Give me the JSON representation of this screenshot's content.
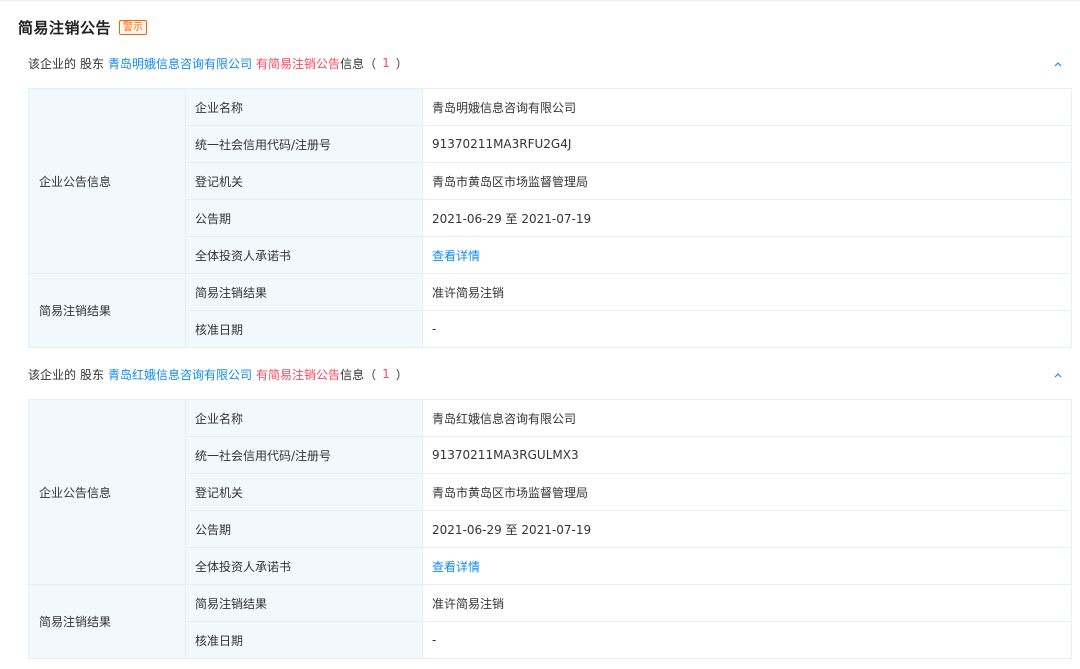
{
  "section": {
    "title": "简易注销公告",
    "badge": "警示"
  },
  "header": {
    "prefix": "该企业的",
    "role": "股东",
    "has_notice": "有简易注销公告",
    "info": "信息",
    "open_paren": "（",
    "close_paren": "）",
    "toggle_icon": "chevron-up-icon"
  },
  "labels": {
    "enterprise_notice": "企业公告信息",
    "result_group": "简易注销结果",
    "company_name": "企业名称",
    "credit_code": "统一社会信用代码/注册号",
    "registration_authority": "登记机关",
    "notice_period": "公告期",
    "investor_commitment": "全体投资人承诺书",
    "cancellation_result": "简易注销结果",
    "approval_date": "核准日期"
  },
  "groups": [
    {
      "shareholder": "青岛明娥信息咨询有限公司",
      "count": "1",
      "company_name": "青岛明娥信息咨询有限公司",
      "credit_code": "91370211MA3RFU2G4J",
      "registration_authority": "青岛市黄岛区市场监督管理局",
      "notice_period": "2021-06-29 至 2021-07-19",
      "investor_commitment": "查看详情",
      "cancellation_result": "准许简易注销",
      "approval_date": "-"
    },
    {
      "shareholder": "青岛红娥信息咨询有限公司",
      "count": "1",
      "company_name": "青岛红娥信息咨询有限公司",
      "credit_code": "91370211MA3RGULMX3",
      "registration_authority": "青岛市黄岛区市场监督管理局",
      "notice_period": "2021-06-29 至 2021-07-19",
      "investor_commitment": "查看详情",
      "cancellation_result": "准许简易注销",
      "approval_date": "-"
    }
  ],
  "colors": {
    "link": "#128bed",
    "highlight": "#fd485e",
    "badge": "#fa6400",
    "label_bg": "#f2f9fc",
    "border": "#e8eef6"
  }
}
